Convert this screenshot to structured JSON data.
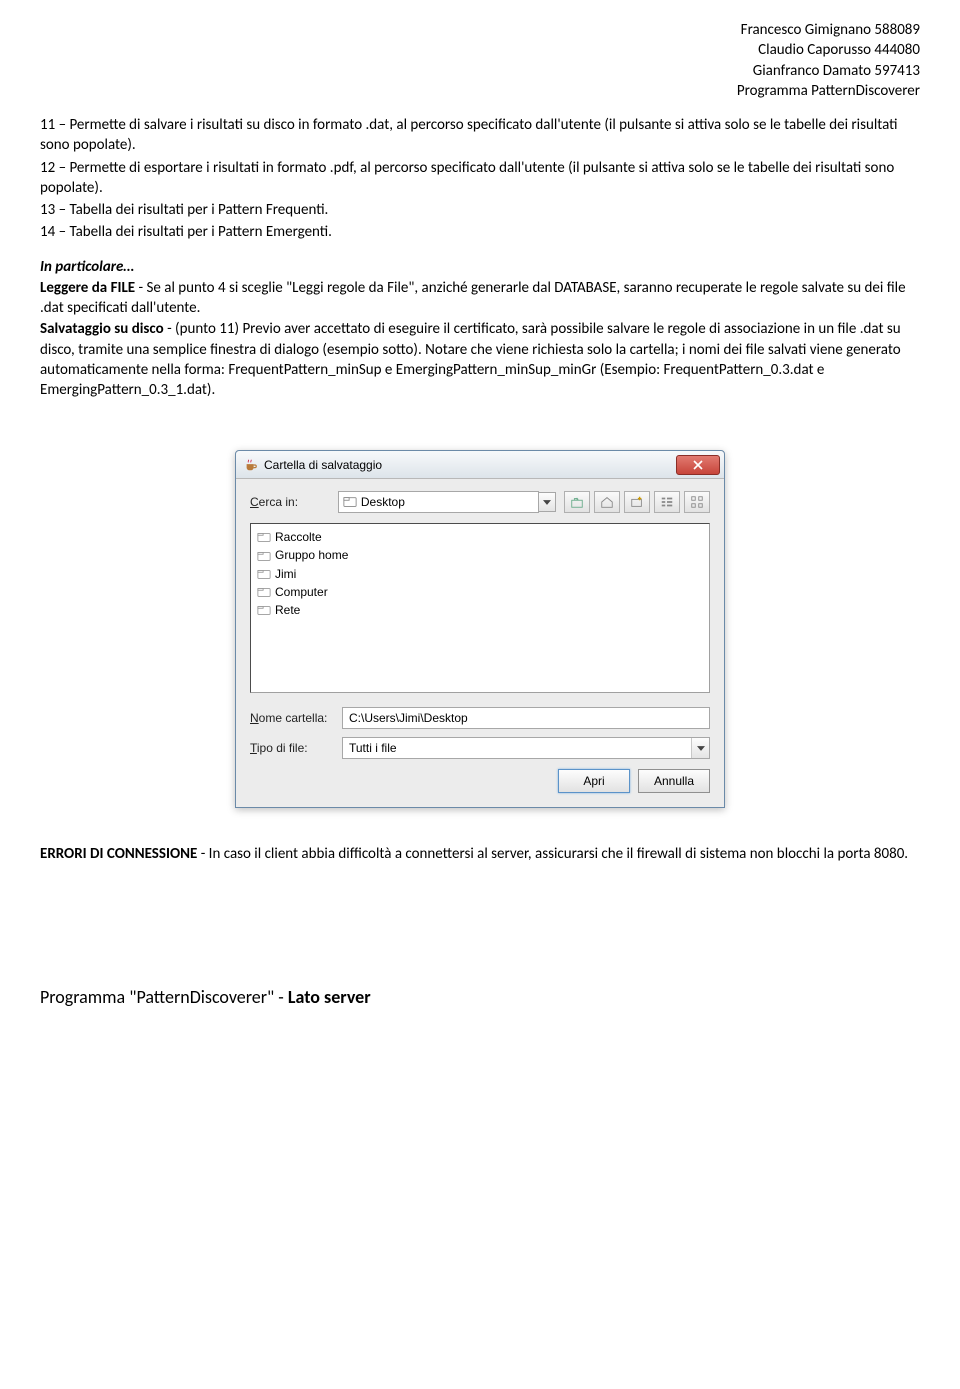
{
  "header": {
    "line1": "Francesco Gimignano 588089",
    "line2": "Claudio Caporusso 444080",
    "line3": "Gianfranco Damato 597413",
    "line4": "Programma PatternDiscoverer"
  },
  "body": {
    "p11": "11 – Permette di salvare i risultati su disco in formato .dat, al percorso specificato dall'utente (il pulsante si attiva solo se le tabelle dei risultati sono popolate).",
    "p12": "12 – Permette di esportare i risultati in formato .pdf, al percorso specificato dall'utente (il pulsante si attiva solo se le tabelle dei risultati sono popolate).",
    "p13": "13 – Tabella dei risultati per i Pattern Frequenti.",
    "p14": "14 – Tabella dei risultati per i Pattern Emergenti."
  },
  "particolare": {
    "title": "In particolare…",
    "leggere_label": "Leggere da FILE",
    "leggere_text": " - Se al punto 4 si sceglie \"Leggi regole da File\", anziché generarle dal DATABASE, saranno recuperate le regole salvate su dei file .dat specificati dall'utente.",
    "salvataggio_label": "Salvataggio su disco",
    "salvataggio_text": " - (punto 11) Previo aver accettato di eseguire il certificato, sarà possibile salvare le regole di associazione in un file .dat  su disco, tramite una semplice finestra di dialogo (esempio sotto). Notare che viene richiesta solo la cartella; i nomi dei file salvati viene generato automaticamente nella forma: FrequentPattern_minSup e EmergingPattern_minSup_minGr (Esempio: FrequentPattern_0.3.dat e EmergingPattern_0.3_1.dat)."
  },
  "dialog": {
    "title": "Cartella di salvataggio",
    "search_in_label": "Cerca in:",
    "search_in_value": "Desktop",
    "list_items": [
      "Raccolte",
      "Gruppo home",
      "Jimi",
      "Computer",
      "Rete"
    ],
    "folder_name_label_u": "N",
    "folder_name_label_rest": "ome cartella:",
    "folder_name_value": "C:\\Users\\Jimi\\Desktop",
    "file_type_label_u": "T",
    "file_type_label_rest": "ipo di file:",
    "file_type_value": "Tutti i file",
    "open_btn": "Apri",
    "cancel_btn": "Annulla"
  },
  "errors": {
    "label": "ERRORI DI CONNESSIONE",
    "text": " - In caso il client abbia difficoltà a connettersi al server, assicurarsi che il firewall di sistema non blocchi la porta 8080."
  },
  "footer": {
    "text_pre": "Programma \"PatternDiscoverer\" - ",
    "text_bold": "Lato server"
  }
}
